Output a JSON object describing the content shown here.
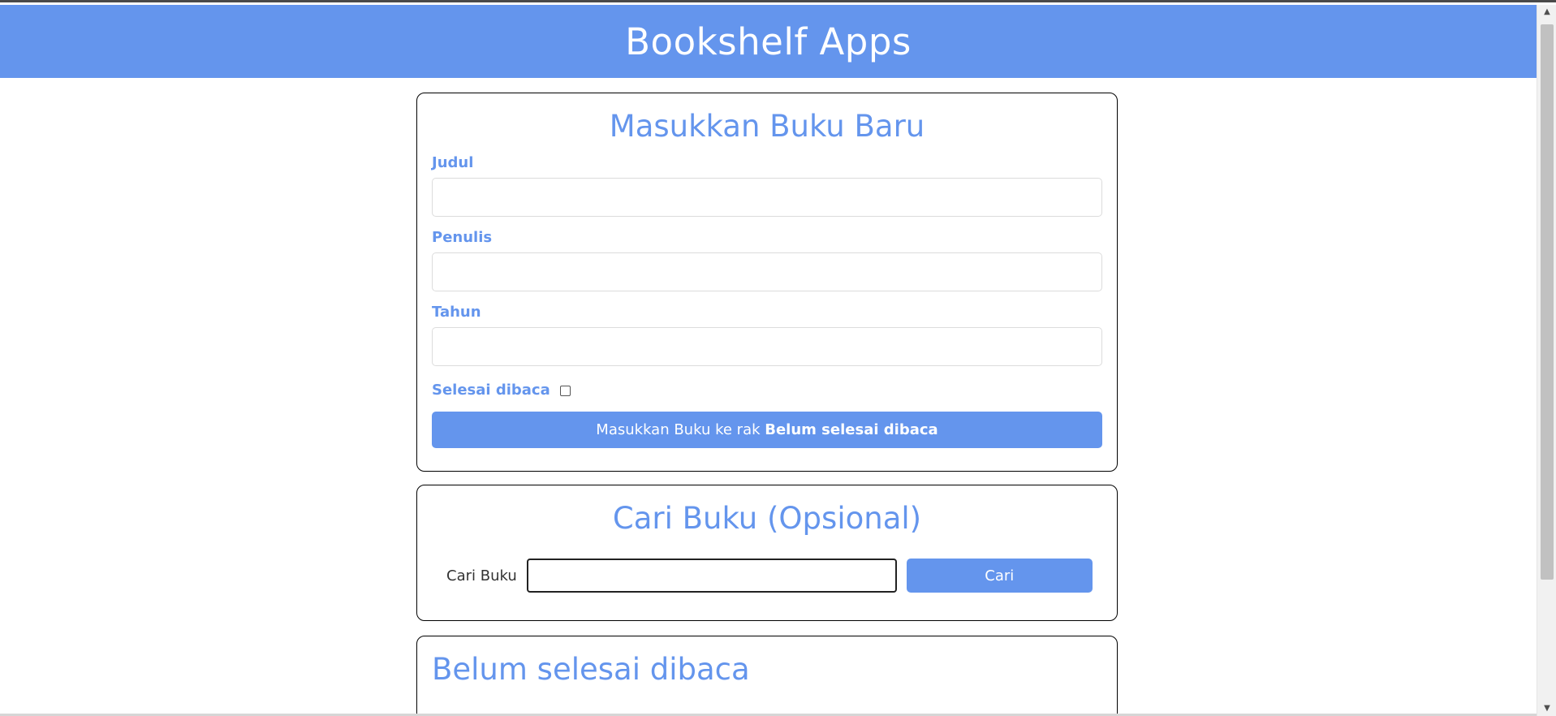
{
  "header": {
    "title": "Bookshelf Apps"
  },
  "input_section": {
    "title": "Masukkan Buku Baru",
    "title_label": "Judul",
    "title_value": "",
    "author_label": "Penulis",
    "author_value": "",
    "year_label": "Tahun",
    "year_value": "",
    "complete_label": "Selesai dibaca",
    "complete_checked": false,
    "submit_prefix": "Masukkan Buku ke rak ",
    "submit_shelf": "Belum selesai dibaca"
  },
  "search_section": {
    "title": "Cari Buku (Opsional)",
    "label": "Cari Buku",
    "value": "",
    "button_label": "Cari"
  },
  "incomplete_shelf": {
    "title": "Belum selesai dibaca"
  },
  "colors": {
    "accent": "#6495ed",
    "border": "#000000"
  },
  "icons": {
    "scroll_up": "triangle-up-icon",
    "scroll_down": "triangle-down-icon"
  }
}
